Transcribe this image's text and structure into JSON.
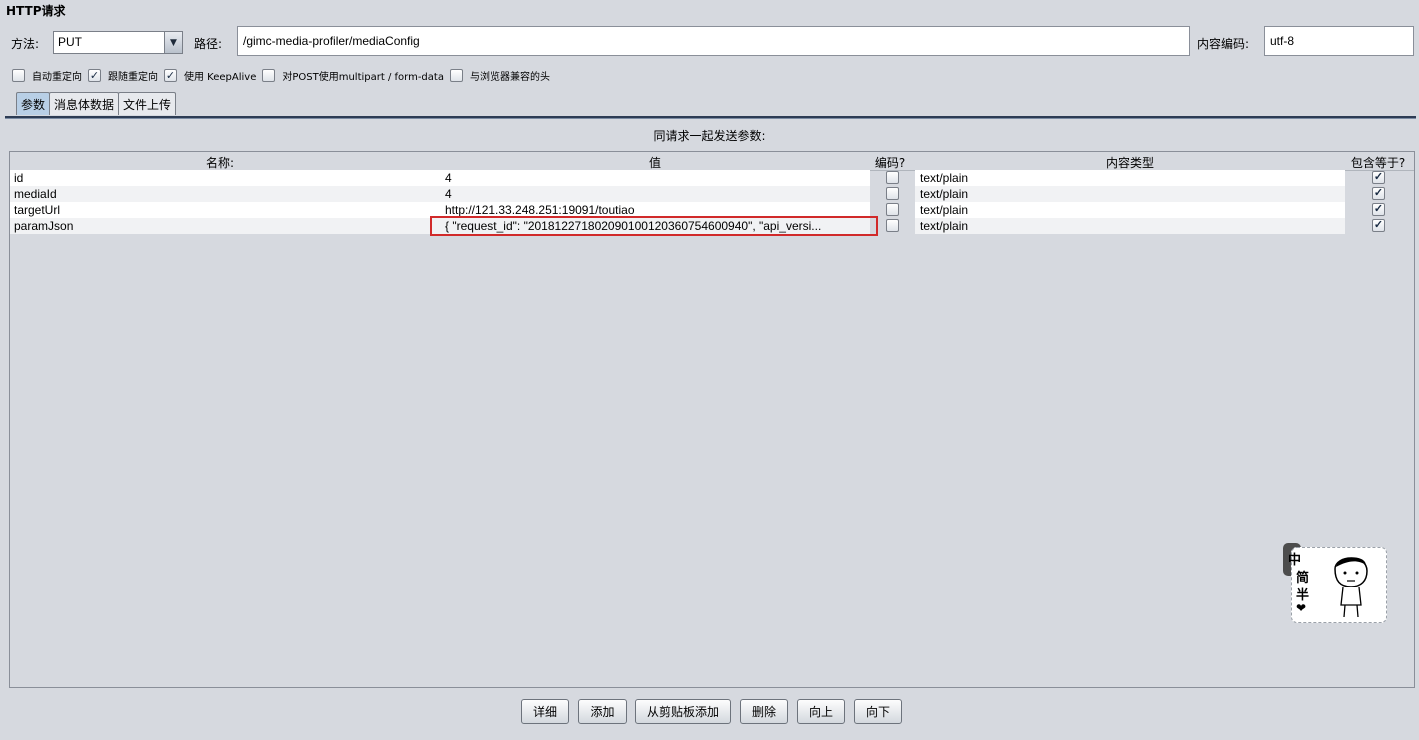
{
  "section_title": "HTTP请求",
  "method": {
    "label": "方法:",
    "value": "PUT"
  },
  "path": {
    "label": "路径:",
    "value": "/gimc-media-profiler/mediaConfig"
  },
  "encoding": {
    "label": "内容编码:",
    "value": "utf-8"
  },
  "options": [
    {
      "label": "自动重定向",
      "checked": false
    },
    {
      "label": "跟随重定向",
      "checked": true
    },
    {
      "label": "使用 KeepAlive",
      "checked": true
    },
    {
      "label": "对POST使用multipart / form-data",
      "checked": false
    },
    {
      "label": "与浏览器兼容的头",
      "checked": false
    }
  ],
  "tabs": [
    "参数",
    "消息体数据",
    "文件上传"
  ],
  "caption": "同请求一起发送参数:",
  "columns": {
    "name": "名称:",
    "value": "值",
    "encode": "编码?",
    "content_type": "内容类型",
    "include_equals": "包含等于?"
  },
  "rows": [
    {
      "name": "id",
      "value": "4",
      "content_type": "text/plain",
      "encode": false,
      "include_equals": true
    },
    {
      "name": "mediaId",
      "value": "4",
      "content_type": "text/plain",
      "encode": false,
      "include_equals": true
    },
    {
      "name": "targetUrl",
      "value": "http://121.33.248.251:19091/toutiao",
      "content_type": "text/plain",
      "encode": false,
      "include_equals": true
    },
    {
      "name": "paramJson",
      "value": "{     \"request_id\": \"20181227180209010012036075460094​0\",      \"api_versi...",
      "content_type": "text/plain",
      "encode": false,
      "include_equals": true
    }
  ],
  "buttons": [
    "详细",
    "添加",
    "从剪贴板添加",
    "删除",
    "向上",
    "向下"
  ],
  "sticker": [
    "中",
    "简",
    "半",
    "❤"
  ]
}
